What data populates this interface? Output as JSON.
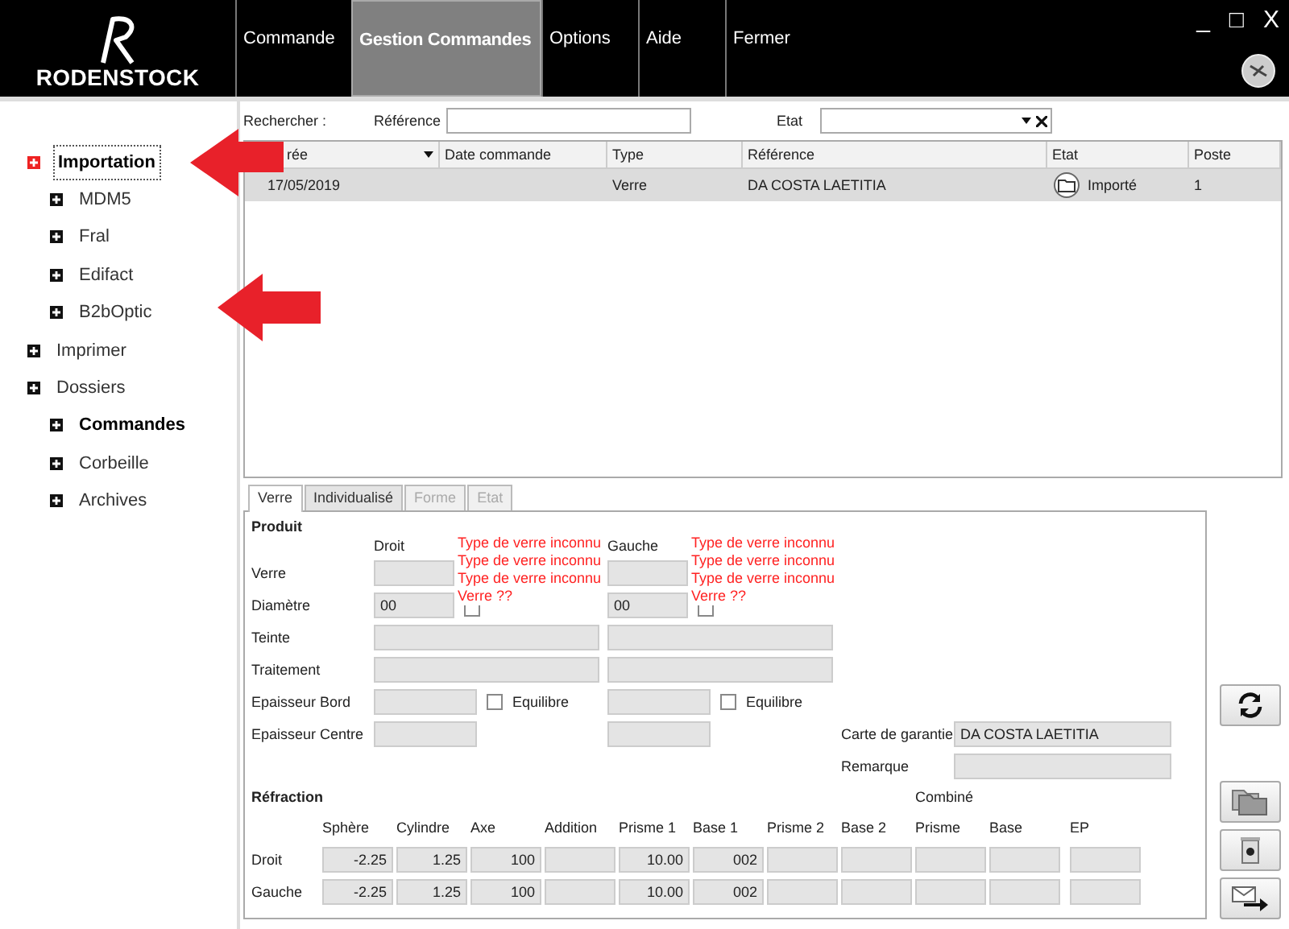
{
  "header": {
    "logo": "RODENSTOCK",
    "menu": [
      {
        "label": "Commande",
        "selected": false
      },
      {
        "label": "Gestion Commandes",
        "selected": true
      },
      {
        "label": "Options",
        "selected": false
      },
      {
        "label": "Aide",
        "selected": false
      },
      {
        "label": "Fermer",
        "selected": false
      }
    ],
    "window_controls": [
      "_",
      "□",
      "X"
    ]
  },
  "sidebar": {
    "items": [
      {
        "label": "Importation",
        "bold": true,
        "selected": true,
        "children": [
          {
            "label": "MDM5",
            "bold": false,
            "selected": false
          },
          {
            "label": "Fral",
            "bold": false,
            "selected": false
          },
          {
            "label": "Edifact",
            "bold": false,
            "selected": false
          },
          {
            "label": "B2bOptic",
            "bold": false,
            "selected": false
          }
        ]
      },
      {
        "label": "Imprimer",
        "bold": false,
        "selected": false
      },
      {
        "label": "Dossiers",
        "bold": false,
        "selected": false,
        "children": [
          {
            "label": "Commandes",
            "bold": true,
            "selected": false
          },
          {
            "label": "Corbeille",
            "bold": false,
            "selected": false
          },
          {
            "label": "Archives",
            "bold": false,
            "selected": false
          }
        ]
      }
    ]
  },
  "search": {
    "label": "Rechercher :",
    "reference_label": "Référence",
    "etat_label": "Etat"
  },
  "table": {
    "columns": [
      {
        "label": "rée",
        "kind": "sort"
      },
      {
        "label": "Date commande",
        "kind": "plain"
      },
      {
        "label": "Type",
        "kind": "plain"
      },
      {
        "label": "Référence",
        "kind": "plain"
      },
      {
        "label": "Etat",
        "kind": "plain"
      },
      {
        "label": "Poste",
        "kind": "plain"
      }
    ],
    "rows": [
      {
        "selected": true,
        "cells": [
          {
            "kind": "text",
            "text": "17/05/2019"
          },
          {
            "kind": "empty"
          },
          {
            "kind": "text",
            "text": "Verre"
          },
          {
            "kind": "text",
            "text": "DA COSTA LAETITIA"
          },
          {
            "kind": "status",
            "text": "Importé"
          },
          {
            "kind": "text",
            "text": "1"
          }
        ]
      }
    ]
  },
  "tabs": [
    {
      "label": "Verre",
      "selected": true,
      "disabled": false
    },
    {
      "label": "Individualisé",
      "selected": false,
      "disabled": false
    },
    {
      "label": "Forme",
      "selected": false,
      "disabled": true
    },
    {
      "label": "Etat",
      "selected": false,
      "disabled": true
    }
  ],
  "product": {
    "title": "Produit",
    "right_header": "Droit",
    "left_header": "Gauche",
    "warnings_right": [
      "Type de verre inconnu",
      "Type de verre inconnu",
      "Type de verre inconnu",
      "Verre ??"
    ],
    "warnings_left": [
      "Type de verre inconnu",
      "Type de verre inconnu",
      "Type de verre inconnu",
      "Verre ??"
    ],
    "rows": [
      {
        "label": "Verre",
        "kind": "short"
      },
      {
        "label": "Diamètre",
        "kind": "check",
        "droit": "00",
        "gauche": "00",
        "droit_check": {
          "checked": false
        },
        "gauche_check": {
          "checked": false
        }
      },
      {
        "label": "Teinte",
        "kind": "wide"
      },
      {
        "label": "Traitement",
        "kind": "wide"
      },
      {
        "label": "Epaisseur Bord",
        "kind": "check",
        "droit_check": {
          "label": "Equilibre",
          "checked": false
        },
        "gauche_check": {
          "label": "Equilibre",
          "checked": false
        }
      },
      {
        "label": "Epaisseur Centre",
        "kind": "short",
        "extra": {
          "label": "Carte de garantie",
          "value": "DA COSTA LAETITIA"
        }
      },
      {
        "kind": "none",
        "extra": {
          "label": "Remarque"
        }
      }
    ]
  },
  "refraction": {
    "title": "Réfraction",
    "group_label": "Combiné",
    "columns": [
      "Sphère",
      "Cylindre",
      "Axe",
      "Addition",
      "Prisme 1",
      "Base 1",
      "Prisme 2",
      "Base 2",
      "Prisme",
      "Base",
      "EP"
    ],
    "rows": [
      {
        "label": "Droit",
        "values": [
          {
            "kind": "text",
            "text": "-2.25"
          },
          {
            "kind": "text",
            "text": "1.25"
          },
          {
            "kind": "text",
            "text": "100"
          },
          {
            "kind": "empty"
          },
          {
            "kind": "text",
            "text": "10.00"
          },
          {
            "kind": "text",
            "text": "002"
          },
          {
            "kind": "empty"
          },
          {
            "kind": "empty"
          },
          {
            "kind": "empty"
          },
          {
            "kind": "empty"
          },
          {
            "kind": "empty"
          }
        ]
      },
      {
        "label": "Gauche",
        "values": [
          {
            "kind": "text",
            "text": "-2.25"
          },
          {
            "kind": "text",
            "text": "1.25"
          },
          {
            "kind": "text",
            "text": "100"
          },
          {
            "kind": "empty"
          },
          {
            "kind": "text",
            "text": "10.00"
          },
          {
            "kind": "text",
            "text": "002"
          },
          {
            "kind": "empty"
          },
          {
            "kind": "empty"
          },
          {
            "kind": "empty"
          },
          {
            "kind": "empty"
          },
          {
            "kind": "empty"
          }
        ]
      }
    ]
  }
}
